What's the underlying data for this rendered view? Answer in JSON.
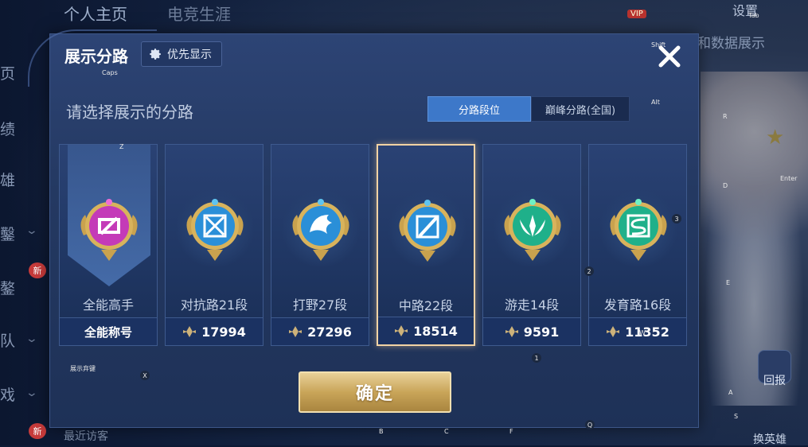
{
  "background": {
    "tabs": [
      "个人主页",
      "电竞生涯"
    ],
    "settings_label": "设置",
    "right_text": "和数据展示",
    "left_items": [
      "页",
      "绩",
      "雄",
      "鑿",
      "鏊",
      "队",
      "戏"
    ],
    "new_badge": "新",
    "vip_label": "VIP",
    "report_label": "回报",
    "switch_label": "换英雄",
    "bottom_text": "最近访客"
  },
  "dialog": {
    "title": "展示分路",
    "priority_label": "优先显示",
    "subtitle": "请选择展示的分路",
    "segments": [
      {
        "label": "分路段位",
        "active": true
      },
      {
        "label": "巅峰分路(全国)",
        "active": false
      }
    ],
    "cards": [
      {
        "name": "全能高手",
        "footer": "全能称号",
        "points": null,
        "emblem": "allround-emblem",
        "color": "#c43ab8",
        "ribbon": true
      },
      {
        "name": "对抗路21段",
        "footer": null,
        "points": "17994",
        "emblem": "clash-lane-emblem",
        "color": "#2a8fd8"
      },
      {
        "name": "打野27段",
        "footer": null,
        "points": "27296",
        "emblem": "jungle-emblem",
        "color": "#2a8fd8"
      },
      {
        "name": "中路22段",
        "footer": null,
        "points": "18514",
        "emblem": "mid-lane-emblem",
        "color": "#2a8fd8",
        "selected": true
      },
      {
        "name": "游走14段",
        "footer": null,
        "points": "9591",
        "emblem": "roam-emblem",
        "color": "#1fb08a"
      },
      {
        "name": "发育路16段",
        "footer": null,
        "points": "11352",
        "emblem": "farm-lane-emblem",
        "color": "#1fb08a"
      }
    ],
    "confirm_label": "确定"
  },
  "key_hints": {
    "shift": "Shift",
    "caps": "Caps",
    "tab": "Tab",
    "alt": "Alt",
    "enter": "Enter",
    "z": "Z",
    "x": "X",
    "r": "R",
    "d": "D",
    "e": "E",
    "a": "A",
    "s": "S",
    "q": "Q",
    "b": "B",
    "c": "C",
    "f": "F",
    "w": "W",
    "n1": "1",
    "n2": "2",
    "n3": "3",
    "display_hint": "展示弃键"
  }
}
